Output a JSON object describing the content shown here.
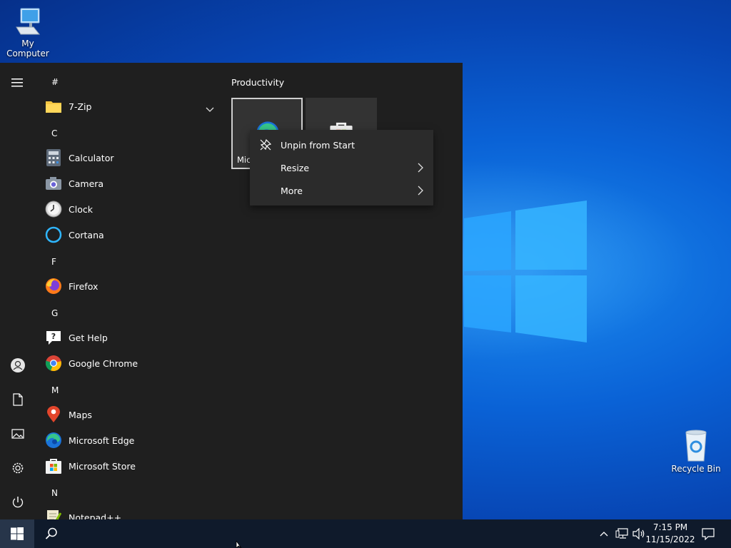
{
  "desktop": {
    "icons": [
      {
        "label": "My Computer",
        "icon": "computer-icon"
      },
      {
        "label": "Recycle Bin",
        "icon": "recycle-bin-icon"
      }
    ]
  },
  "start_menu": {
    "app_list": {
      "headers": [
        "#",
        "C",
        "F",
        "G",
        "M",
        "N"
      ],
      "apps": [
        {
          "label": "7-Zip",
          "icon": "folder-icon",
          "expandable": true
        },
        {
          "label": "Calculator",
          "icon": "calculator-icon"
        },
        {
          "label": "Camera",
          "icon": "camera-icon"
        },
        {
          "label": "Clock",
          "icon": "clock-icon"
        },
        {
          "label": "Cortana",
          "icon": "cortana-icon"
        },
        {
          "label": "Firefox",
          "icon": "firefox-icon"
        },
        {
          "label": "Get Help",
          "icon": "get-help-icon"
        },
        {
          "label": "Google Chrome",
          "icon": "chrome-icon"
        },
        {
          "label": "Maps",
          "icon": "maps-icon"
        },
        {
          "label": "Microsoft Edge",
          "icon": "edge-icon"
        },
        {
          "label": "Microsoft Store",
          "icon": "store-icon"
        },
        {
          "label": "Notepad++",
          "icon": "notepad-icon"
        }
      ]
    },
    "tiles": {
      "group_title": "Productivity",
      "items": [
        {
          "label": "Mic",
          "icon": "edge-icon",
          "selected": true
        },
        {
          "label": "",
          "icon": "store-icon",
          "selected": false
        }
      ]
    },
    "context_menu": {
      "items": [
        {
          "label": "Unpin from Start",
          "icon": "unpin-icon",
          "submenu": false
        },
        {
          "label": "Resize",
          "submenu": true
        },
        {
          "label": "More",
          "submenu": true
        }
      ]
    }
  },
  "taskbar": {
    "clock": {
      "time": "7:15 PM",
      "date": "11/15/2022"
    }
  },
  "colors": {
    "start_bg": "#1f1f1f",
    "context_bg": "#2b2b2b",
    "taskbar_bg": "#0f1a2b",
    "accent": "#0a62d6"
  }
}
